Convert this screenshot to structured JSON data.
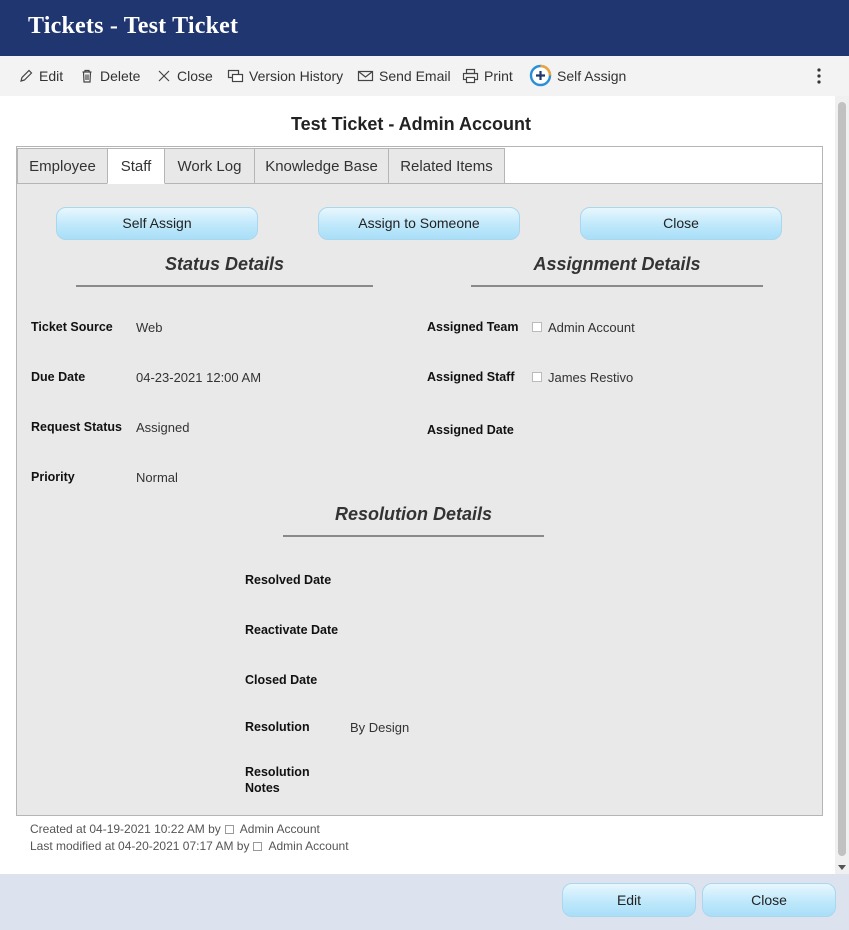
{
  "window": {
    "title": "Tickets - Test Ticket"
  },
  "toolbar": {
    "edit": "Edit",
    "delete": "Delete",
    "close": "Close",
    "version_history": "Version History",
    "send_email": "Send Email",
    "print": "Print",
    "self_assign": "Self Assign",
    "more_icon": "vertical-ellipsis"
  },
  "ticket": {
    "heading": "Test Ticket - Admin Account"
  },
  "tabs": [
    {
      "label": "Employee"
    },
    {
      "label": "Staff",
      "active": true
    },
    {
      "label": "Work Log"
    },
    {
      "label": "Knowledge Base"
    },
    {
      "label": "Related Items"
    }
  ],
  "actions": {
    "self_assign": "Self Assign",
    "assign_to_someone": "Assign to Someone",
    "close": "Close"
  },
  "status_details": {
    "heading": "Status Details",
    "ticket_source_label": "Ticket Source",
    "ticket_source": "Web",
    "due_date_label": "Due Date",
    "due_date": "04-23-2021 12:00 AM",
    "request_status_label": "Request Status",
    "request_status": "Assigned",
    "priority_label": "Priority",
    "priority": "Normal"
  },
  "assignment_details": {
    "heading": "Assignment Details",
    "assigned_team_label": "Assigned Team",
    "assigned_team": "Admin Account",
    "assigned_staff_label": "Assigned Staff",
    "assigned_staff": "James Restivo",
    "assigned_date_label": "Assigned Date"
  },
  "resolution_details": {
    "heading": "Resolution Details",
    "resolved_date_label": "Resolved Date",
    "reactivate_date_label": "Reactivate Date",
    "closed_date_label": "Closed Date",
    "resolution_label": "Resolution",
    "resolution": "By Design",
    "resolution_notes_label_1": "Resolution",
    "resolution_notes_label_2": "Notes"
  },
  "meta": {
    "created_prefix": "Created at 04-19-2021 10:22 AM by",
    "created_by": "Admin Account",
    "modified_prefix": "Last modified at 04-20-2021 07:17 AM by",
    "modified_by": "Admin Account"
  },
  "footer": {
    "edit": "Edit",
    "close": "Close"
  },
  "colors": {
    "titlebar": "#1f3670",
    "panel": "#e9e9e9",
    "button_blue": "#bfe8fb",
    "footer": "#dde3ee"
  }
}
